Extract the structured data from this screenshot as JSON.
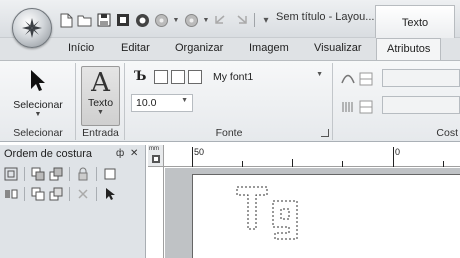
{
  "window": {
    "title": "Sem título - Layou...",
    "context_tab": "Texto"
  },
  "tabs": [
    "Início",
    "Editar",
    "Organizar",
    "Imagem",
    "Visualizar",
    "Atributos"
  ],
  "active_tab": "Atributos",
  "ribbon": {
    "select_button": "Selecionar",
    "select_group": "Selecionar",
    "text_button": "Texto",
    "entrada_group": "Entrada",
    "font_name": "My font1",
    "font_size": "10.0",
    "font_group": "Fonte",
    "costura_group": "Cost"
  },
  "panel": {
    "title": "Ordem de costura",
    "pin": "ф",
    "close": "✕"
  },
  "rulers": {
    "unit": "mm",
    "mark_50": "50",
    "mark_0": "0"
  },
  "canvas": {
    "sample_text": "Tg"
  },
  "colors": {
    "ribbon_bg": "#e6e9ec",
    "panel_bg": "#dfe3e7",
    "workspace": "#bfc2c5"
  }
}
